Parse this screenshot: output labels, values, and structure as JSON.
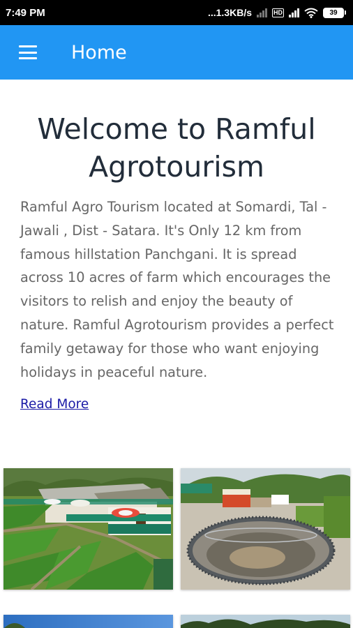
{
  "status_bar": {
    "time": "7:49 PM",
    "speed": "...1.3KB/s",
    "hd": "HD",
    "battery": "39",
    "icons": [
      "signal-icon",
      "hd-icon",
      "signal-4g-icon",
      "wifi-icon",
      "battery-icon"
    ]
  },
  "app_bar": {
    "menu_icon": "hamburger-menu-icon",
    "title": "Home",
    "color": "#2196f3"
  },
  "main": {
    "title": "Welcome to Ramful Agrotourism",
    "description": "Ramful Agro Tourism located at Somardi, Tal - Jawali , Dist - Satara.  It's Only 12 km from famous hillstation Panchgani. It is spread across 10 acres of farm which encourages the visitors to relish and enjoy the beauty of nature. Ramful Agrotourism provides a perfect family getaway for those who want enjoying holidays in peaceful nature.",
    "read_more_label": "Read More",
    "link_color": "#1a1aa6"
  },
  "gallery": {
    "images": [
      "farm cottages with lawns and umbrellas",
      "circular well with cottages",
      "sky and trees",
      "trees"
    ]
  }
}
